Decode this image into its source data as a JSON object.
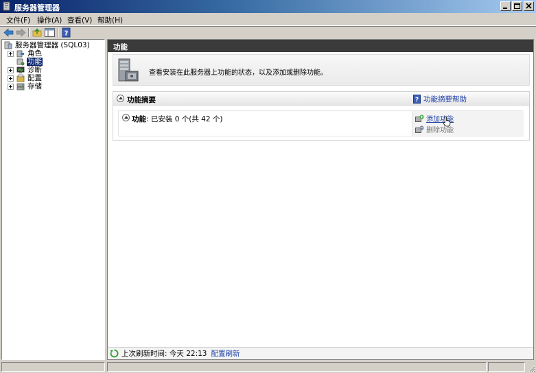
{
  "window": {
    "title": "服务器管理器",
    "buttons": [
      "minimize",
      "restore",
      "close"
    ]
  },
  "menu": {
    "items": [
      "文件(F)",
      "操作(A)",
      "查看(V)",
      "帮助(H)"
    ]
  },
  "toolbar": {
    "icons": [
      "back-arrow-icon",
      "forward-arrow-icon",
      "up-folder-icon",
      "show-hide-tree-icon",
      "help-icon"
    ]
  },
  "tree": {
    "root": "服务器管理器 (SQL03)",
    "items": [
      {
        "label": "角色",
        "icon": "roles-icon",
        "expandable": true,
        "selected": false
      },
      {
        "label": "功能",
        "icon": "features-icon",
        "expandable": false,
        "selected": true
      },
      {
        "label": "诊断",
        "icon": "diagnostics-icon",
        "expandable": true,
        "selected": false
      },
      {
        "label": "配置",
        "icon": "configuration-icon",
        "expandable": true,
        "selected": false
      },
      {
        "label": "存储",
        "icon": "storage-icon",
        "expandable": true,
        "selected": false
      }
    ]
  },
  "content": {
    "header": "功能",
    "intro_text": "查看安装在此服务器上功能的状态，以及添加或删除功能。",
    "summary": {
      "title": "功能摘要",
      "help_link": "功能摘要帮助",
      "features_label": "功能",
      "features_status": ": 已安装 0 个(共 42 个)",
      "actions": {
        "add": "添加功能",
        "remove": "删除功能"
      }
    },
    "footer": {
      "last_refresh": "上次刷新时间: 今天 22:13",
      "configure_refresh": "配置刷新"
    }
  },
  "colors": {
    "title_bar": "#0a246a",
    "content_header": "#3b3b3b",
    "link": "#1c3fa8",
    "selection": "#0a246a"
  }
}
